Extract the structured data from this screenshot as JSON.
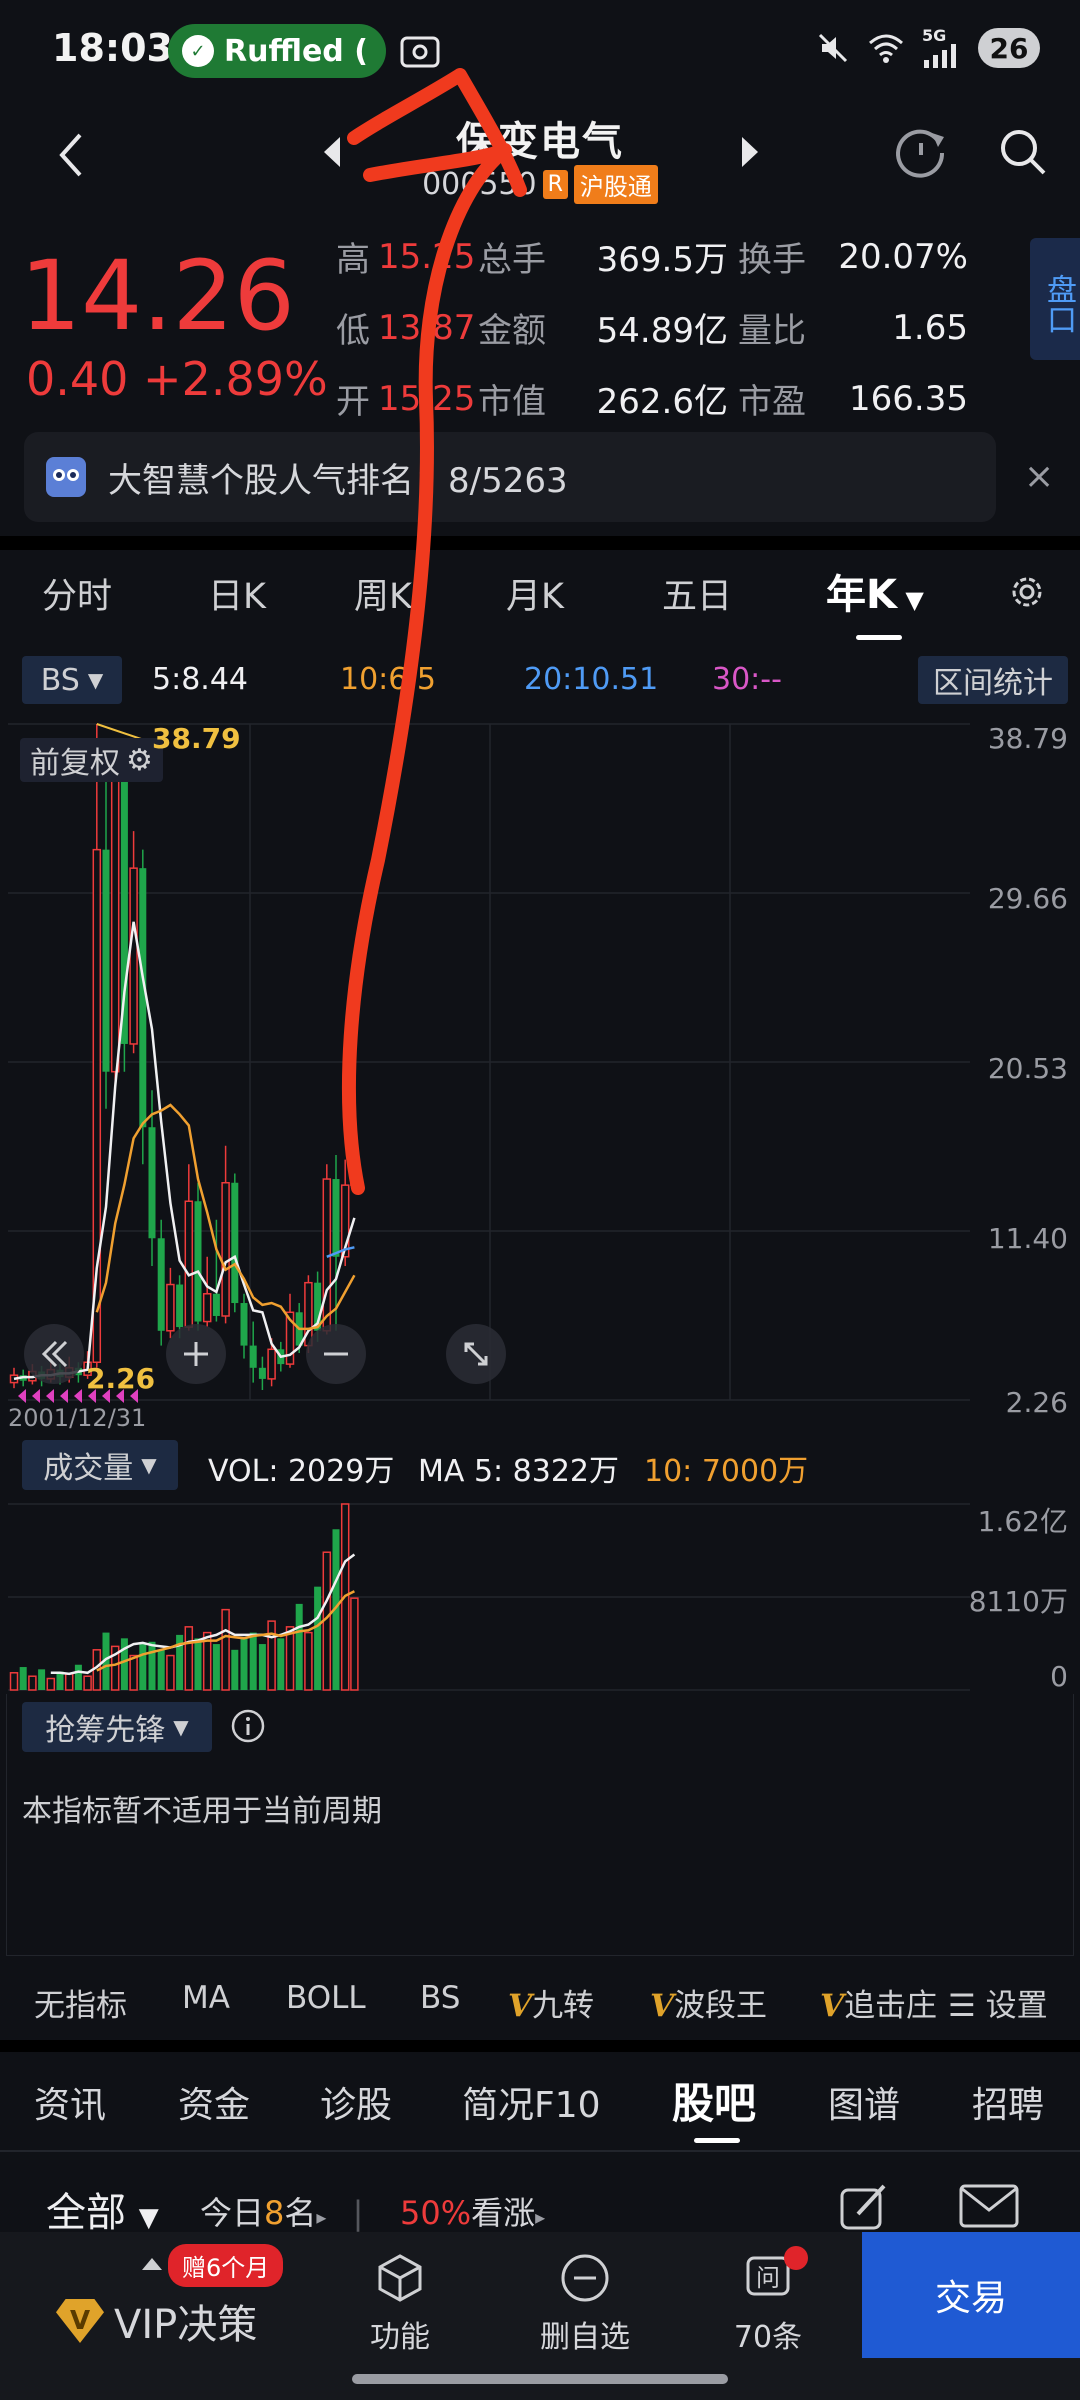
{
  "status_bar": {
    "time": "18:03",
    "app_pill_label": "Ruffled (",
    "network": "5G",
    "battery": "26"
  },
  "header": {
    "stock_name": "保变电气",
    "stock_code": "00055",
    "code_suffix": "0",
    "tag_r": "R",
    "tag_connect": "沪股通"
  },
  "quote": {
    "price": "14.26",
    "change": "0.40 +2.89%",
    "rows": [
      {
        "l1": "高",
        "v1": "15.25",
        "l2": "总手",
        "v2": "369.5万",
        "l3": "换手",
        "v3": "20.07%"
      },
      {
        "l1": "低",
        "v1": "13.87",
        "l2": "金额",
        "v2": "54.89亿",
        "l3": "量比",
        "v3": "1.65"
      },
      {
        "l1": "开",
        "v1": "15.25",
        "l2": "市值",
        "v2": "262.6亿",
        "l3": "市盈",
        "v3": "166.35"
      }
    ],
    "pankou": "盘口"
  },
  "banner": {
    "text": "大智慧个股人气排名：8/5263",
    "close": "×"
  },
  "period_tabs": [
    "分时",
    "日K",
    "周K",
    "月K",
    "五日",
    "年K"
  ],
  "active_period": "年K",
  "indicators": {
    "bs": "BS",
    "ma5": "5:8.44",
    "ma10": "10:6.5",
    "ma20": "20:10.51",
    "ma30": "30:--",
    "range_stats": "区间统计",
    "qfq": "前复权"
  },
  "chart_data": {
    "type": "candlestick",
    "y_ticks": [
      "38.79",
      "29.66",
      "20.53",
      "11.40",
      "2.26"
    ],
    "ylim": [
      2.26,
      38.79
    ],
    "max_label": "38.79",
    "min_label": "2.26",
    "start_date": "2001/12/31",
    "candles": [
      {
        "o": 3.2,
        "c": 3.6,
        "h": 4.0,
        "l": 2.9
      },
      {
        "o": 3.6,
        "c": 3.3,
        "h": 3.9,
        "l": 3.0
      },
      {
        "o": 3.3,
        "c": 3.8,
        "h": 4.2,
        "l": 3.1
      },
      {
        "o": 3.8,
        "c": 3.4,
        "h": 4.1,
        "l": 3.0
      },
      {
        "o": 3.4,
        "c": 3.9,
        "h": 4.4,
        "l": 3.2
      },
      {
        "o": 3.9,
        "c": 3.5,
        "h": 4.2,
        "l": 3.1
      },
      {
        "o": 3.5,
        "c": 4.0,
        "h": 4.6,
        "l": 3.2
      },
      {
        "o": 4.0,
        "c": 3.6,
        "h": 4.3,
        "l": 3.2
      },
      {
        "o": 3.6,
        "c": 4.3,
        "h": 4.9,
        "l": 3.4
      },
      {
        "o": 4.3,
        "c": 32.0,
        "h": 38.79,
        "l": 4.0
      },
      {
        "o": 32.0,
        "c": 20.0,
        "h": 36.0,
        "l": 18.0
      },
      {
        "o": 20.0,
        "c": 36.0,
        "h": 38.0,
        "l": 19.0
      },
      {
        "o": 36.0,
        "c": 21.5,
        "h": 37.0,
        "l": 20.0
      },
      {
        "o": 21.5,
        "c": 31.0,
        "h": 33.0,
        "l": 21.0
      },
      {
        "o": 31.0,
        "c": 17.0,
        "h": 32.0,
        "l": 15.0
      },
      {
        "o": 17.0,
        "c": 11.0,
        "h": 19.0,
        "l": 9.5
      },
      {
        "o": 11.0,
        "c": 6.0,
        "h": 12.0,
        "l": 5.2
      },
      {
        "o": 6.0,
        "c": 8.5,
        "h": 9.4,
        "l": 5.6
      },
      {
        "o": 8.5,
        "c": 6.2,
        "h": 9.0,
        "l": 5.6
      },
      {
        "o": 6.2,
        "c": 13.0,
        "h": 15.0,
        "l": 6.0
      },
      {
        "o": 13.0,
        "c": 6.5,
        "h": 14.0,
        "l": 6.0
      },
      {
        "o": 6.5,
        "c": 8.0,
        "h": 10.0,
        "l": 6.2
      },
      {
        "o": 8.0,
        "c": 6.8,
        "h": 12.0,
        "l": 6.5
      },
      {
        "o": 6.8,
        "c": 14.0,
        "h": 16.0,
        "l": 6.4
      },
      {
        "o": 14.0,
        "c": 7.5,
        "h": 14.5,
        "l": 7.0
      },
      {
        "o": 7.5,
        "c": 5.2,
        "h": 8.0,
        "l": 4.5
      },
      {
        "o": 5.2,
        "c": 4.0,
        "h": 6.5,
        "l": 3.2
      },
      {
        "o": 4.0,
        "c": 3.4,
        "h": 4.6,
        "l": 2.8
      },
      {
        "o": 3.4,
        "c": 5.0,
        "h": 5.6,
        "l": 3.0
      },
      {
        "o": 5.0,
        "c": 4.2,
        "h": 5.4,
        "l": 3.8
      },
      {
        "o": 4.2,
        "c": 7.0,
        "h": 8.0,
        "l": 4.0
      },
      {
        "o": 7.0,
        "c": 5.2,
        "h": 7.5,
        "l": 4.8
      },
      {
        "o": 5.2,
        "c": 8.6,
        "h": 9.0,
        "l": 4.8
      },
      {
        "o": 8.6,
        "c": 6.0,
        "h": 9.2,
        "l": 5.4
      },
      {
        "o": 6.0,
        "c": 14.2,
        "h": 15.0,
        "l": 5.8
      },
      {
        "o": 14.2,
        "c": 10.0,
        "h": 15.5,
        "l": 6.0
      },
      {
        "o": 10.0,
        "c": 13.87,
        "h": 15.25,
        "l": 9.5
      },
      {
        "o": 13.87,
        "c": 14.26,
        "h": 15.25,
        "l": 13.87
      }
    ],
    "ma5": [
      3.4,
      3.5,
      3.5,
      3.6,
      3.6,
      3.7,
      3.7,
      3.8,
      3.9,
      9.4,
      12.7,
      19.2,
      24.3,
      28.1,
      25.1,
      22.3,
      17.3,
      12.9,
      9.8,
      9.0,
      9.2,
      8.4,
      8.1,
      9.7,
      10.0,
      8.5,
      7.1,
      7.0,
      5.3,
      4.6,
      4.7,
      5.1,
      6.0,
      6.4,
      8.2,
      8.8,
      10.5,
      12.1
    ],
    "ma10": [
      null,
      null,
      null,
      null,
      null,
      null,
      null,
      null,
      null,
      7.0,
      8.6,
      11.8,
      13.9,
      16.4,
      17.2,
      17.7,
      17.9,
      18.2,
      17.7,
      17.1,
      14.2,
      12.4,
      10.4,
      9.3,
      9.6,
      8.8,
      7.8,
      7.4,
      7.5,
      7.3,
      6.6,
      6.1,
      6.1,
      6.2,
      6.8,
      7.2,
      8.1,
      9.0
    ],
    "ma20": [
      null,
      null,
      null,
      null,
      null,
      null,
      null,
      null,
      null,
      null,
      null,
      null,
      null,
      null,
      null,
      null,
      null,
      null,
      null,
      null,
      null,
      null,
      null,
      null,
      null,
      null,
      null,
      null,
      null,
      null,
      null,
      null,
      null,
      null,
      10.0,
      10.2,
      10.4,
      10.51
    ],
    "vol_title": "成交量",
    "vol_label": "VOL: 2029万",
    "vol_ma5": "MA 5: 8322万",
    "vol_ma10": "10: 7000万",
    "vol_ticks": [
      "1.62亿",
      "8110万",
      "0"
    ],
    "volumes": [
      0.15,
      0.2,
      0.12,
      0.18,
      0.1,
      0.16,
      0.14,
      0.22,
      0.12,
      0.35,
      0.5,
      0.38,
      0.45,
      0.3,
      0.4,
      0.42,
      0.35,
      0.3,
      0.48,
      0.55,
      0.45,
      0.5,
      0.4,
      0.7,
      0.35,
      0.45,
      0.5,
      0.4,
      0.6,
      0.45,
      0.55,
      0.75,
      0.5,
      0.9,
      1.2,
      1.4,
      1.62,
      0.8
    ],
    "vol_ma5_line": [
      null,
      null,
      null,
      null,
      0.15,
      0.15,
      0.14,
      0.16,
      0.15,
      0.2,
      0.27,
      0.31,
      0.36,
      0.4,
      0.41,
      0.39,
      0.38,
      0.37,
      0.39,
      0.42,
      0.43,
      0.46,
      0.48,
      0.52,
      0.48,
      0.48,
      0.48,
      0.48,
      0.46,
      0.48,
      0.51,
      0.55,
      0.57,
      0.63,
      0.78,
      0.95,
      1.12,
      1.18
    ],
    "vol_ma10_line": [
      null,
      null,
      null,
      null,
      null,
      null,
      null,
      null,
      null,
      0.17,
      0.21,
      0.22,
      0.25,
      0.28,
      0.31,
      0.33,
      0.35,
      0.37,
      0.4,
      0.41,
      0.42,
      0.43,
      0.43,
      0.47,
      0.46,
      0.45,
      0.47,
      0.48,
      0.49,
      0.47,
      0.49,
      0.51,
      0.52,
      0.56,
      0.63,
      0.72,
      0.82,
      0.86
    ]
  },
  "chip": {
    "title": "抢筹先锋",
    "note": "本指标暂不适用于当前周期"
  },
  "indicator_row": [
    {
      "label": "无指标",
      "style": "plain"
    },
    {
      "label": "MA",
      "style": "plain"
    },
    {
      "label": "BOLL",
      "style": "plain"
    },
    {
      "label": "BS",
      "style": "blue"
    },
    {
      "label": "九转",
      "style": "vip"
    },
    {
      "label": "波段王",
      "style": "vip"
    },
    {
      "label": "追击庄",
      "style": "vip"
    }
  ],
  "indicator_settings": "设置",
  "bottom_tabs": [
    "资讯",
    "资金",
    "诊股",
    "简况F10",
    "股吧",
    "图谱",
    "招聘"
  ],
  "active_bottom_tab": "股吧",
  "filter": {
    "all": "全部",
    "today_prefix": "今日",
    "today_count": "8",
    "today_suffix": "名",
    "bull_pct": "50%",
    "bull_text": "看涨"
  },
  "bottom_bar": {
    "vip_badge": "赠6个月",
    "vip_label": "VIP决策",
    "func": "功能",
    "delete_fav": "删自选",
    "ask": "70条",
    "trade": "交易"
  }
}
